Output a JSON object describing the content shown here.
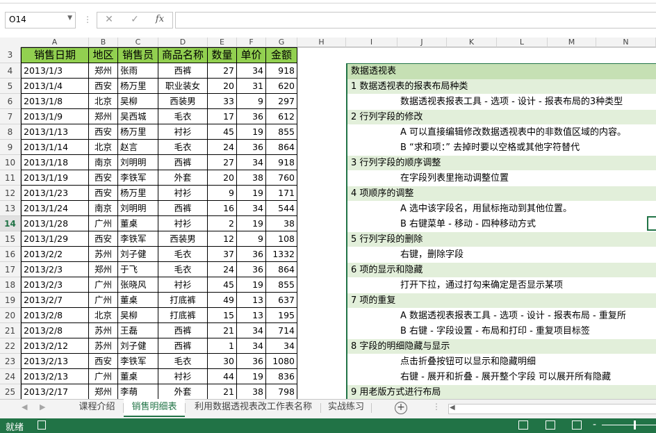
{
  "formula_bar": {
    "name_box": "O14",
    "cancel_icon": "✕",
    "enter_icon": "✓",
    "fx_label": "fx",
    "formula": ""
  },
  "columns": [
    "A",
    "B",
    "C",
    "D",
    "E",
    "F",
    "G",
    "H",
    "I",
    "J",
    "K",
    "L",
    "M",
    "N"
  ],
  "active_row": "14",
  "table": {
    "headers": [
      "销售日期",
      "地区",
      "销售员",
      "商品名称",
      "数量",
      "单价",
      "金额"
    ],
    "rows": [
      [
        "2013/1/3",
        "郑州",
        "张雨",
        "西裤",
        "27",
        "34",
        "918"
      ],
      [
        "2013/1/4",
        "西安",
        "杨万里",
        "职业装女",
        "20",
        "31",
        "620"
      ],
      [
        "2013/1/8",
        "北京",
        "吴柳",
        "西装男",
        "33",
        "9",
        "297"
      ],
      [
        "2013/1/9",
        "郑州",
        "吴西城",
        "毛衣",
        "17",
        "36",
        "612"
      ],
      [
        "2013/1/13",
        "西安",
        "杨万里",
        "衬衫",
        "45",
        "19",
        "855"
      ],
      [
        "2013/1/14",
        "北京",
        "赵言",
        "毛衣",
        "24",
        "36",
        "864"
      ],
      [
        "2013/1/18",
        "南京",
        "刘明明",
        "西裤",
        "27",
        "34",
        "918"
      ],
      [
        "2013/1/19",
        "西安",
        "李铁军",
        "外套",
        "20",
        "38",
        "760"
      ],
      [
        "2013/1/23",
        "西安",
        "杨万里",
        "衬衫",
        "9",
        "19",
        "171"
      ],
      [
        "2013/1/24",
        "南京",
        "刘明明",
        "西裤",
        "16",
        "34",
        "544"
      ],
      [
        "2013/1/28",
        "广州",
        "董桌",
        "衬衫",
        "2",
        "19",
        "38"
      ],
      [
        "2013/1/29",
        "西安",
        "李铁军",
        "西装男",
        "12",
        "9",
        "108"
      ],
      [
        "2013/2/2",
        "苏州",
        "刘子健",
        "毛衣",
        "37",
        "36",
        "1332"
      ],
      [
        "2013/2/3",
        "郑州",
        "于飞",
        "毛衣",
        "24",
        "36",
        "864"
      ],
      [
        "2013/2/3",
        "广州",
        "张晓风",
        "衬衫",
        "45",
        "19",
        "855"
      ],
      [
        "2013/2/7",
        "广州",
        "董桌",
        "打底裤",
        "49",
        "13",
        "637"
      ],
      [
        "2013/2/8",
        "北京",
        "吴柳",
        "打底裤",
        "15",
        "13",
        "195"
      ],
      [
        "2013/2/8",
        "苏州",
        "王磊",
        "西裤",
        "21",
        "34",
        "714"
      ],
      [
        "2013/2/12",
        "苏州",
        "刘子健",
        "西裤",
        "1",
        "34",
        "34"
      ],
      [
        "2013/2/13",
        "西安",
        "李铁军",
        "毛衣",
        "30",
        "36",
        "1080"
      ],
      [
        "2013/2/13",
        "广州",
        "董桌",
        "衬衫",
        "44",
        "19",
        "836"
      ],
      [
        "2013/2/17",
        "郑州",
        "李萌",
        "外套",
        "21",
        "38",
        "798"
      ]
    ]
  },
  "panel": {
    "lines": [
      {
        "kind": "title",
        "text": "数据透视表"
      },
      {
        "kind": "head",
        "text": "1 数据透视表的报表布局种类"
      },
      {
        "kind": "sub",
        "text": "数据透视表报表工具 - 选项 - 设计 - 报表布局的3种类型"
      },
      {
        "kind": "head",
        "text": "2 行列字段的修改"
      },
      {
        "kind": "sub",
        "text": "A 可以直接编辑修改数据透视表中的非数值区域的内容。"
      },
      {
        "kind": "sub",
        "text": "B “求和项：” 去掉时要以空格或其他字符替代"
      },
      {
        "kind": "head",
        "text": "3 行列字段的顺序调整"
      },
      {
        "kind": "sub",
        "text": "在字段列表里拖动调整位置"
      },
      {
        "kind": "head",
        "text": "4 项顺序的调整"
      },
      {
        "kind": "sub",
        "text": "A 选中该字段名，用鼠标拖动到其他位置。"
      },
      {
        "kind": "sub",
        "text": "B 右键菜单 - 移动 - 四种移动方式"
      },
      {
        "kind": "head",
        "text": "5 行列字段的删除"
      },
      {
        "kind": "sub",
        "text": "右键，删除字段"
      },
      {
        "kind": "head",
        "text": "6 项的显示和隐藏"
      },
      {
        "kind": "sub",
        "text": "打开下拉，通过打勾来确定是否显示某项"
      },
      {
        "kind": "head",
        "text": "7 项的重复"
      },
      {
        "kind": "sub",
        "text": "A 数据透视表报表工具 - 选项 - 设计 - 报表布局 - 重复所"
      },
      {
        "kind": "sub",
        "text": "B 右键 - 字段设置 - 布局和打印 - 重复项目标签"
      },
      {
        "kind": "head",
        "text": "8 字段的明细隐藏与显示"
      },
      {
        "kind": "sub",
        "text": "点击折叠按钮可以显示和隐藏明细"
      },
      {
        "kind": "sub",
        "text": "右键 - 展开和折叠 - 展开整个字段 可以展开所有隐藏"
      },
      {
        "kind": "head",
        "text": "9 用老版方式进行布局"
      }
    ]
  },
  "sheet_tabs": [
    "课程介绍",
    "销售明细表",
    "利用数据透视表改工作表名称",
    "实战练习"
  ],
  "active_tab": "销售明细表",
  "status": {
    "text": "就绪"
  },
  "colors": {
    "accent": "#217346",
    "header_fill": "#92d050",
    "panel_title": "#c6e0b4",
    "panel_head": "#e2efda"
  }
}
